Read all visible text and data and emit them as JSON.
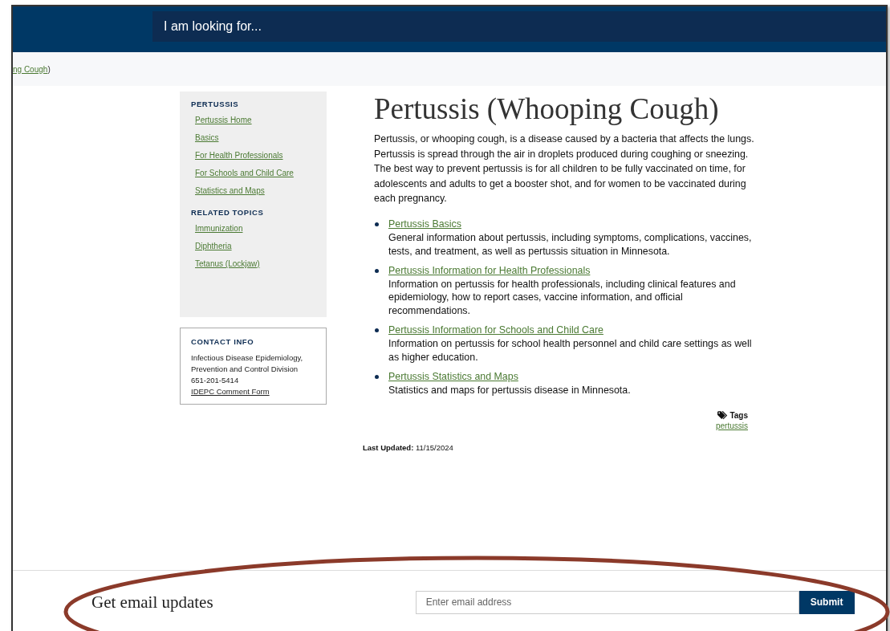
{
  "header": {
    "search": {
      "placeholder": "I am looking for..."
    }
  },
  "breadcrumb": {
    "link": "ng Cough",
    "tail": ")"
  },
  "sidebar": {
    "sections": [
      {
        "heading": "PERTUSSIS",
        "links": [
          "Pertussis Home",
          "Basics",
          "For Health Professionals",
          "For Schools and Child Care",
          "Statistics and Maps"
        ]
      },
      {
        "heading": "RELATED TOPICS",
        "links": [
          "Immunization",
          "Diphtheria",
          "Tetanus (Lockjaw)"
        ]
      }
    ]
  },
  "contact": {
    "heading": "CONTACT INFO",
    "lines": [
      "Infectious Disease Epidemiology,",
      "Prevention and Control Division",
      "651-201-5414"
    ],
    "link": "IDEPC Comment Form"
  },
  "main": {
    "title": "Pertussis (Whooping Cough)",
    "intro": "Pertussis, or whooping cough, is a disease caused by a bacteria that affects the lungs. Pertussis is spread through the air in droplets produced during coughing or sneezing. The best way to prevent pertussis is for all children to be fully vaccinated on time, for adolescents and adults to get a booster shot, and for women to be vaccinated during each pregnancy.",
    "items": [
      {
        "link": "Pertussis Basics",
        "text": "General information about pertussis, including symptoms, complications, vaccines, tests, and treatment, as well as pertussis situation in Minnesota."
      },
      {
        "link": "Pertussis Information for Health Professionals",
        "text": "Information on pertussis for health professionals, including clinical features and epidemiology, how to report cases, vaccine information, and official recommendations."
      },
      {
        "link": "Pertussis Information for Schools and Child Care",
        "text": "Information on pertussis for school health personnel and child care settings as well as higher education."
      },
      {
        "link": "Pertussis Statistics and Maps",
        "text": "Statistics and maps for pertussis disease in Minnesota."
      }
    ],
    "tags": {
      "label": "Tags",
      "links": [
        "pertussis"
      ]
    },
    "updated": "**Last Updated:** 11/15/2024"
  },
  "footer": {
    "heading": "Get email updates",
    "email": {
      "placeholder": "Enter email address"
    },
    "submit": "Submit"
  }
}
